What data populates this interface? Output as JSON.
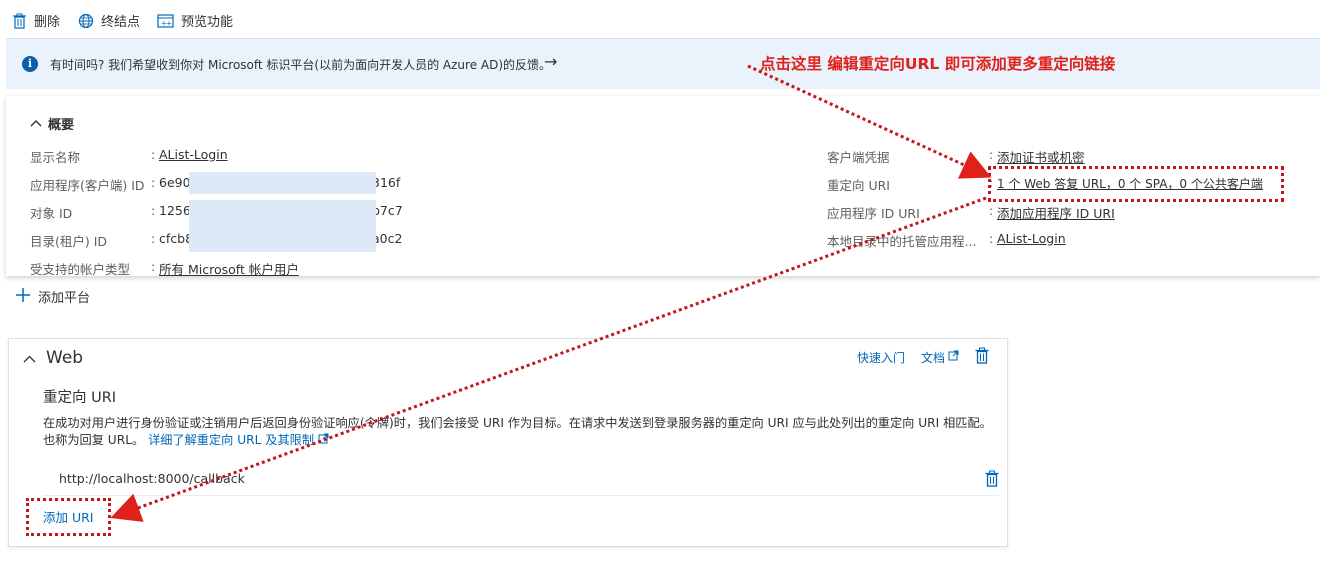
{
  "toolbar": {
    "delete_label": "删除",
    "endpoints_label": "终结点",
    "preview_label": "预览功能"
  },
  "banner": {
    "text": "有时间吗? 我们希望收到你对 Microsoft 标识平台(以前为面向开发人员的 Azure AD)的反馈。",
    "arrow": "→"
  },
  "overview": {
    "heading": "概要",
    "left": [
      {
        "label": "显示名称",
        "value": "AList-Login",
        "link": true
      },
      {
        "label": "应用程序(客户端) ID",
        "value_prefix": "6e90a",
        "value_suffix": "316f"
      },
      {
        "label": "对象 ID",
        "value_prefix": "1256a",
        "value_suffix": "b7c7"
      },
      {
        "label": "目录(租户) ID",
        "value_prefix": "cfcb8",
        "value_suffix": "a0c2"
      },
      {
        "label": "受支持的帐户类型",
        "value": "所有 Microsoft 帐户用户",
        "link": true
      }
    ],
    "right": [
      {
        "label": "客户端凭据",
        "value": "添加证书或机密"
      },
      {
        "label": "重定向 URI",
        "value": "1 个 Web 答复 URL，0 个 SPA，0 个公共客户端"
      },
      {
        "label": "应用程序 ID URI",
        "value": "添加应用程序 ID URI"
      },
      {
        "label": "本地目录中的托管应用程...",
        "value": "AList-Login"
      }
    ],
    "colon": ":"
  },
  "add_platform": {
    "label": "添加平台"
  },
  "web_card": {
    "title": "Web",
    "quickstart": "快速入门",
    "docs": "文档",
    "section_title": "重定向 URI",
    "description": "在成功对用户进行身份验证或注销用户后返回身份验证响应(令牌)时，我们会接受 URI 作为目标。在请求中发送到登录服务器的重定向 URI 应与此处列出的重定向 URI 相匹配。也称为回复 URL。",
    "learn_more": "详细了解重定向 URL 及其限制",
    "uri": "http://localhost:8000/callback",
    "add_uri": "添加 URI"
  },
  "annotation": {
    "text": "点击这里 编辑重定向URL 即可添加更多重定向链接",
    "color": "#e0201b"
  },
  "colors": {
    "link": "#0067b8",
    "banner_bg": "#eaf2fb",
    "annotation": "#c4161c"
  }
}
